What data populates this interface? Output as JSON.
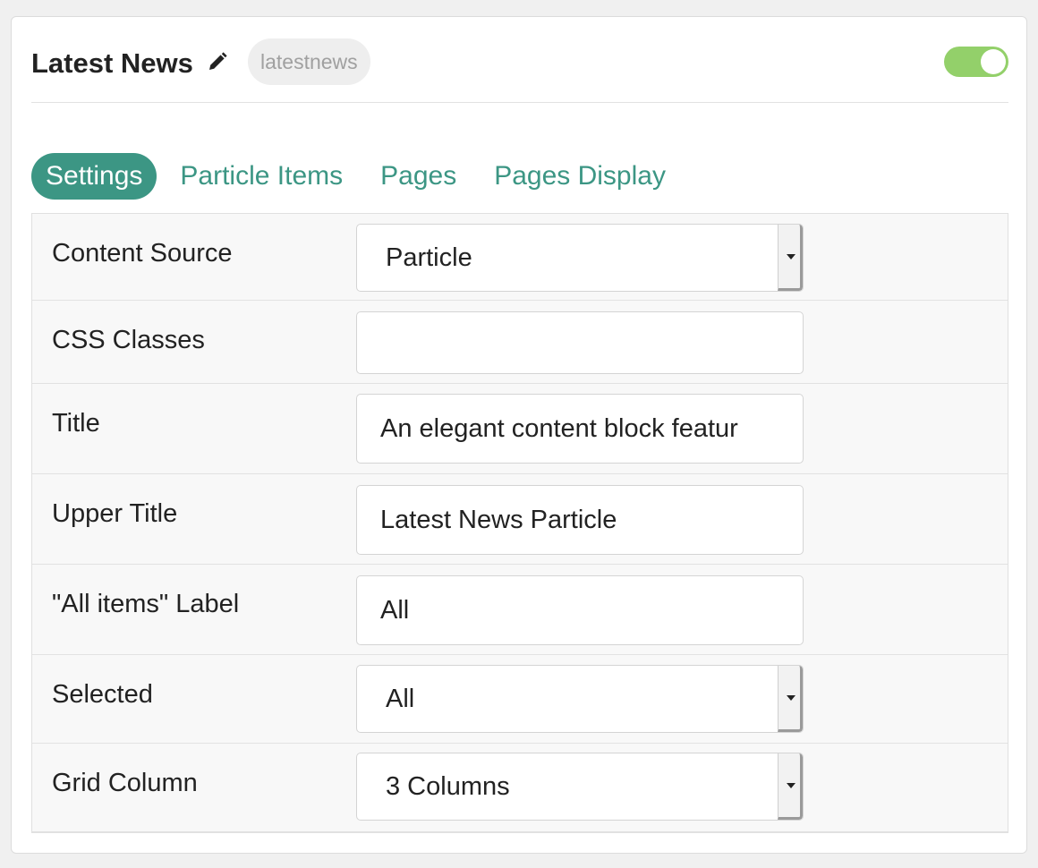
{
  "header": {
    "title": "Latest News",
    "edit_icon": "pencil-icon",
    "slug": "latestnews",
    "enabled": true,
    "toggle_color": "#93d06a"
  },
  "tabs": [
    {
      "label": "Settings",
      "active": true
    },
    {
      "label": "Particle Items",
      "active": false
    },
    {
      "label": "Pages",
      "active": false
    },
    {
      "label": "Pages Display",
      "active": false
    }
  ],
  "accent_color": "#3c9684",
  "form": {
    "content_source": {
      "label": "Content Source",
      "value": "Particle"
    },
    "css_classes": {
      "label": "CSS Classes",
      "value": ""
    },
    "title": {
      "label": "Title",
      "value": "An elegant content block featur"
    },
    "upper_title": {
      "label": "Upper Title",
      "value": "Latest News Particle"
    },
    "all_items_label": {
      "label": "\"All items\" Label",
      "value": "All"
    },
    "selected": {
      "label": "Selected",
      "value": "All"
    },
    "grid_column": {
      "label": "Grid Column",
      "value": "3 Columns"
    }
  }
}
